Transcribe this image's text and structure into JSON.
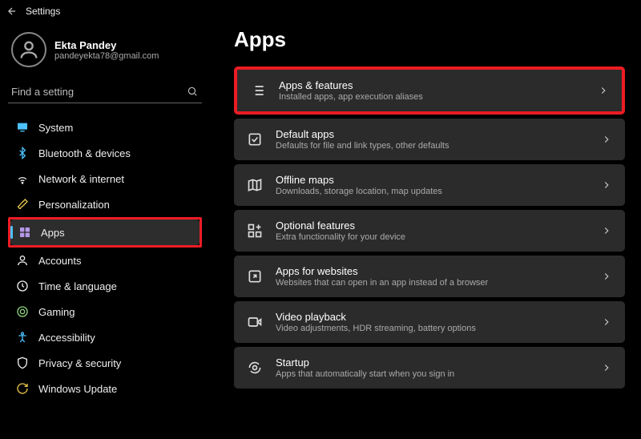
{
  "window": {
    "title": "Settings"
  },
  "profile": {
    "name": "Ekta Pandey",
    "email": "pandeyekta78@gmail.com"
  },
  "search": {
    "placeholder": "Find a setting"
  },
  "sidebar": {
    "items": [
      {
        "label": "System"
      },
      {
        "label": "Bluetooth & devices"
      },
      {
        "label": "Network & internet"
      },
      {
        "label": "Personalization"
      },
      {
        "label": "Apps"
      },
      {
        "label": "Accounts"
      },
      {
        "label": "Time & language"
      },
      {
        "label": "Gaming"
      },
      {
        "label": "Accessibility"
      },
      {
        "label": "Privacy & security"
      },
      {
        "label": "Windows Update"
      }
    ]
  },
  "main": {
    "heading": "Apps",
    "cards": [
      {
        "title": "Apps & features",
        "sub": "Installed apps, app execution aliases"
      },
      {
        "title": "Default apps",
        "sub": "Defaults for file and link types, other defaults"
      },
      {
        "title": "Offline maps",
        "sub": "Downloads, storage location, map updates"
      },
      {
        "title": "Optional features",
        "sub": "Extra functionality for your device"
      },
      {
        "title": "Apps for websites",
        "sub": "Websites that can open in an app instead of a browser"
      },
      {
        "title": "Video playback",
        "sub": "Video adjustments, HDR streaming, battery options"
      },
      {
        "title": "Startup",
        "sub": "Apps that automatically start when you sign in"
      }
    ]
  }
}
